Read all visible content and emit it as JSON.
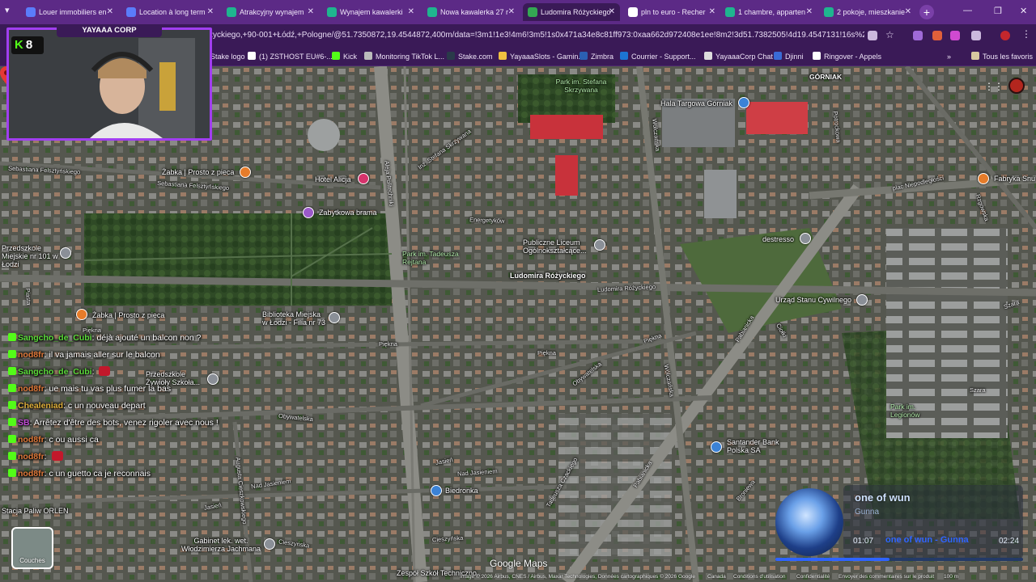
{
  "browser": {
    "tabs": [
      {
        "title": "Louer immobiliers en",
        "color": "#5b7cfa",
        "active": false
      },
      {
        "title": "Location à long term",
        "color": "#5b7cfa",
        "active": false
      },
      {
        "title": "Atrakcyjny wynajem",
        "color": "#1fb58f",
        "active": false
      },
      {
        "title": "Wynajem kawalerki",
        "color": "#1fb58f",
        "active": false
      },
      {
        "title": "Nowa kawalerka 27 r",
        "color": "#1fb58f",
        "active": false
      },
      {
        "title": "Ludomira Różyckiego",
        "color": "#34a853",
        "active": true
      },
      {
        "title": "pln to euro - Recher",
        "color": "#ffffff",
        "active": false
      },
      {
        "title": "1 chambre, apparten",
        "color": "#1fb58f",
        "active": false
      },
      {
        "title": "2 pokoje, mieszkanie",
        "color": "#1fb58f",
        "active": false
      }
    ],
    "tab_menu_icon": "▾",
    "tab_close_icon": "✕",
    "new_tab_icon": "+",
    "window_controls": {
      "minimize": "—",
      "maximize": "❐",
      "close": "✕"
    },
    "url": "życkiego,+90-001+Łódź,+Pologne/@51.7350872,19.4544872,400m/data=!3m1!1e3!4m6!3m5!1s0x471a34e8c81ff973:0xaa662d972408e1ee!8m2!3d51.7382505!4d19.4547131!16s%2Fg%2F1tcyd...",
    "bookmarks": [
      {
        "label": "Stake logo",
        "color": "#2a3a4a"
      },
      {
        "label": "(1) ZSTHOST EU#6-...",
        "color": "#ffffff"
      },
      {
        "label": "Kick",
        "color": "#53fc18"
      },
      {
        "label": "Monitoring TikTok L...",
        "color": "#bbbbbb"
      },
      {
        "label": "Stake.com",
        "color": "#2a3a4a"
      },
      {
        "label": "YayaaaSlots - Gamin...",
        "color": "#f0c040"
      },
      {
        "label": "Zimbra",
        "color": "#2b5fb3"
      },
      {
        "label": "Courrier - Support...",
        "color": "#1c74d4"
      },
      {
        "label": "YayaaaCorp Chat",
        "color": "#dddddd"
      },
      {
        "label": "Djinni",
        "color": "#3a6bd6"
      },
      {
        "label": "Ringover - Appels",
        "color": "#ffffff"
      }
    ],
    "bookmarks_more": "»",
    "all_bookmarks": "Tous les favoris"
  },
  "map": {
    "areas": [
      {
        "name": "GÓRNIAK"
      },
      {
        "name": "Park im. Stefana Skrzywana"
      },
      {
        "name": "Park im. Tadeusza Rejtana"
      },
      {
        "name": "Park im. Legionów"
      }
    ],
    "streets": [
      "Sebastiana Felsztyńskiego",
      "Sebastiana Felsztyńskiego",
      "Aleja Politechniki",
      "Inż. Stefana Skrzywana",
      "Energetyków",
      "Wólczańska",
      "Ludomira Różyckiego",
      "Piękna",
      "Piękna",
      "Piękna",
      "Piękna",
      "Obywatelska",
      "Obywatelska",
      "Augusta Cieszkowskiego",
      "Jasień",
      "Jasień",
      "Nad Jasieniem",
      "Nad Jasieniem",
      "Cieszyńska",
      "Cieszyńska",
      "Tadeusza Czackiego",
      "Pabianicka",
      "Pabianicka",
      "Wólczańska",
      "plac Niepodległości",
      "Rzgowska",
      "Szara",
      "Szara",
      "Broniewa",
      "Potrockowa",
      "Ciołki",
      "Piastа"
    ],
    "pois": [
      {
        "label": "Żabka | Prosto z pieca",
        "kind": "orange"
      },
      {
        "label": "Hotel Alicja",
        "kind": "pink"
      },
      {
        "label": "Zabytkowa brama",
        "kind": "purple"
      },
      {
        "label": "Przedszkole Miejskie nr 101 w Łodzi",
        "kind": "gray"
      },
      {
        "label": "Żabka | Prosto z pieca",
        "kind": "orange"
      },
      {
        "label": "Biblioteka Miejska w Łodzi - Filia nr 73",
        "kind": "gray"
      },
      {
        "label": "Publiczne Liceum Ogólnokształcące...",
        "kind": "gray"
      },
      {
        "label": "Ludomira Różyckiego",
        "kind": "red"
      },
      {
        "label": "Hala Targowa Górniak",
        "kind": "blue"
      },
      {
        "label": "destresso",
        "kind": "gray"
      },
      {
        "label": "Urząd Stanu Cywilnego",
        "kind": "gray"
      },
      {
        "label": "Fabryka Snu",
        "kind": "orange"
      },
      {
        "label": "Przedszkole Żywioły Szkoła...",
        "kind": "gray"
      },
      {
        "label": "Santander Bank Polska SA",
        "kind": "blue"
      },
      {
        "label": "Biedronka",
        "kind": "blue"
      },
      {
        "label": "Stacja Paliw ORLEN",
        "kind": "gray"
      },
      {
        "label": "Gabinet lek. wet. Włodzimierza Jachmana",
        "kind": "gray"
      },
      {
        "label": "Zespół Szkół Techniczno...",
        "kind": "gray"
      }
    ],
    "layers_label": "Couches",
    "logo": "Google Maps",
    "footer": {
      "imagery": "Image © 2026 Airbus, CNES / Airbus, Maxar Technologies, Données cartographiques © 2026 Google",
      "country": "Canada",
      "terms": "Conditions d'utilisation",
      "privacy": "Confidentialité",
      "feedback": "Envoyer des commentaires sur le produit",
      "scale": "100 m"
    },
    "apps_icon": "⋮⋮"
  },
  "stream": {
    "channel": "YAYAAA CORP",
    "viewer_count": "8",
    "kick_letter": "K",
    "chat": [
      {
        "user": "Sangcho_de_Cubi",
        "user_color": "#5bdc3a",
        "text": "déjà ajouté un balcon non ?"
      },
      {
        "user": "nod8fr",
        "user_color": "#e07a3b",
        "text": "il va jamais aller sur le balcon"
      },
      {
        "user": "Sangcho_de_Cubi",
        "user_color": "#5bdc3a",
        "text": ""
      },
      {
        "user": "nod8fr",
        "user_color": "#e07a3b",
        "text": "ue mais tu vas plus fumer la bas"
      },
      {
        "user": "Chealeniad",
        "user_color": "#e0b03b",
        "text": "c un nouveau depart"
      },
      {
        "user": "SB",
        "user_color": "#c04bd6",
        "text": "Arrêtez d'être des bots, venez rigoler avec nous !"
      },
      {
        "user": "nod8fr",
        "user_color": "#e07a3b",
        "text": "c ou aussi ca"
      },
      {
        "user": "nod8fr",
        "user_color": "#e07a3b",
        "text": ""
      },
      {
        "user": "nod8fr",
        "user_color": "#e07a3b",
        "text": "c un guetto ca je reconnais"
      }
    ],
    "player": {
      "title": "one of wun",
      "artist": "Gunna",
      "elapsed": "01:07",
      "total": "02:24",
      "scroll_text": "one of wun - Gunna",
      "progress": 0.46
    }
  }
}
